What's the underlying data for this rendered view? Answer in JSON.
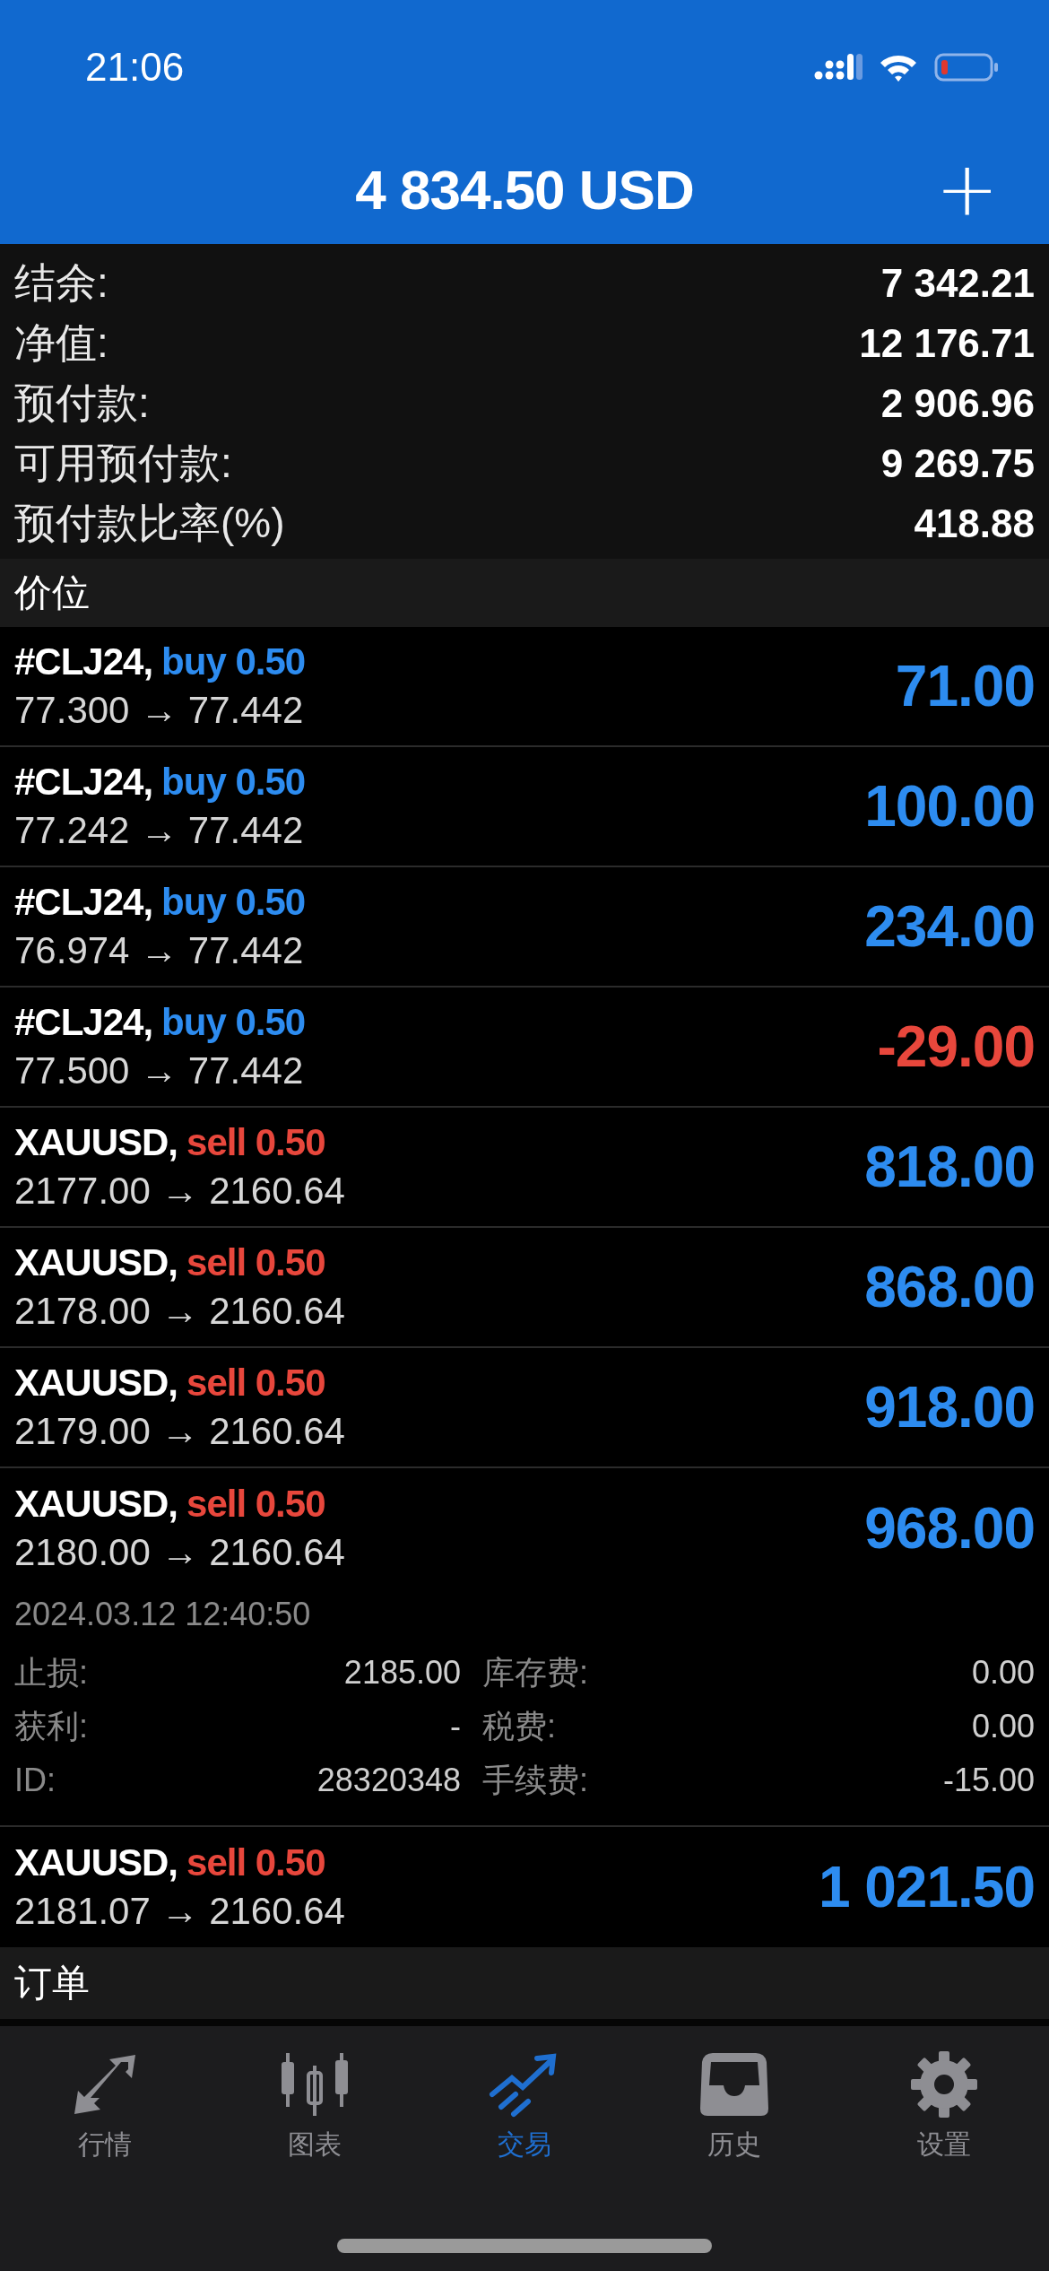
{
  "status_bar": {
    "time": "21:06"
  },
  "header": {
    "title": "4 834.50 USD",
    "action": "+"
  },
  "summary": [
    {
      "label": "结余:",
      "value": "7 342.21"
    },
    {
      "label": "净值:",
      "value": "12 176.71"
    },
    {
      "label": "预付款:",
      "value": "2 906.96"
    },
    {
      "label": "可用预付款:",
      "value": "9 269.75"
    },
    {
      "label": "预付款比率(%)",
      "value": "418.88"
    }
  ],
  "positions_section": "价位",
  "positions": [
    {
      "symbol": "#CLJ24,",
      "kind": "buy",
      "order": "buy 0.50",
      "prices": "77.300 → 77.442",
      "profit": "71.00",
      "loss": false
    },
    {
      "symbol": "#CLJ24,",
      "kind": "buy",
      "order": "buy 0.50",
      "prices": "77.242 → 77.442",
      "profit": "100.00",
      "loss": false
    },
    {
      "symbol": "#CLJ24,",
      "kind": "buy",
      "order": "buy 0.50",
      "prices": "76.974 → 77.442",
      "profit": "234.00",
      "loss": false
    },
    {
      "symbol": "#CLJ24,",
      "kind": "buy",
      "order": "buy 0.50",
      "prices": "77.500 → 77.442",
      "profit": "-29.00",
      "loss": true
    },
    {
      "symbol": "XAUUSD,",
      "kind": "sell",
      "order": "sell 0.50",
      "prices": "2177.00 → 2160.64",
      "profit": "818.00",
      "loss": false
    },
    {
      "symbol": "XAUUSD,",
      "kind": "sell",
      "order": "sell 0.50",
      "prices": "2178.00 → 2160.64",
      "profit": "868.00",
      "loss": false
    },
    {
      "symbol": "XAUUSD,",
      "kind": "sell",
      "order": "sell 0.50",
      "prices": "2179.00 → 2160.64",
      "profit": "918.00",
      "loss": false
    },
    {
      "symbol": "XAUUSD,",
      "kind": "sell",
      "order": "sell 0.50",
      "prices": "2180.00 → 2160.64",
      "profit": "968.00",
      "loss": false,
      "details": {
        "time": "2024.03.12 12:40:50",
        "left": [
          {
            "label": "止损:",
            "value": "2185.00"
          },
          {
            "label": "获利:",
            "value": "-"
          },
          {
            "label": "ID:",
            "value": "28320348"
          }
        ],
        "right": [
          {
            "label": "库存费:",
            "value": "0.00"
          },
          {
            "label": "税费:",
            "value": "0.00"
          },
          {
            "label": "手续费:",
            "value": "-15.00"
          }
        ]
      }
    },
    {
      "symbol": "XAUUSD,",
      "kind": "sell",
      "order": "sell 0.50",
      "prices": "2181.07 → 2160.64",
      "profit": "1 021.50",
      "loss": false
    }
  ],
  "orders_section": "订单",
  "tabs": [
    {
      "label": "行情",
      "selected": false
    },
    {
      "label": "图表",
      "selected": false
    },
    {
      "label": "交易",
      "selected": true
    },
    {
      "label": "历史",
      "selected": false
    },
    {
      "label": "设置",
      "selected": false
    }
  ]
}
